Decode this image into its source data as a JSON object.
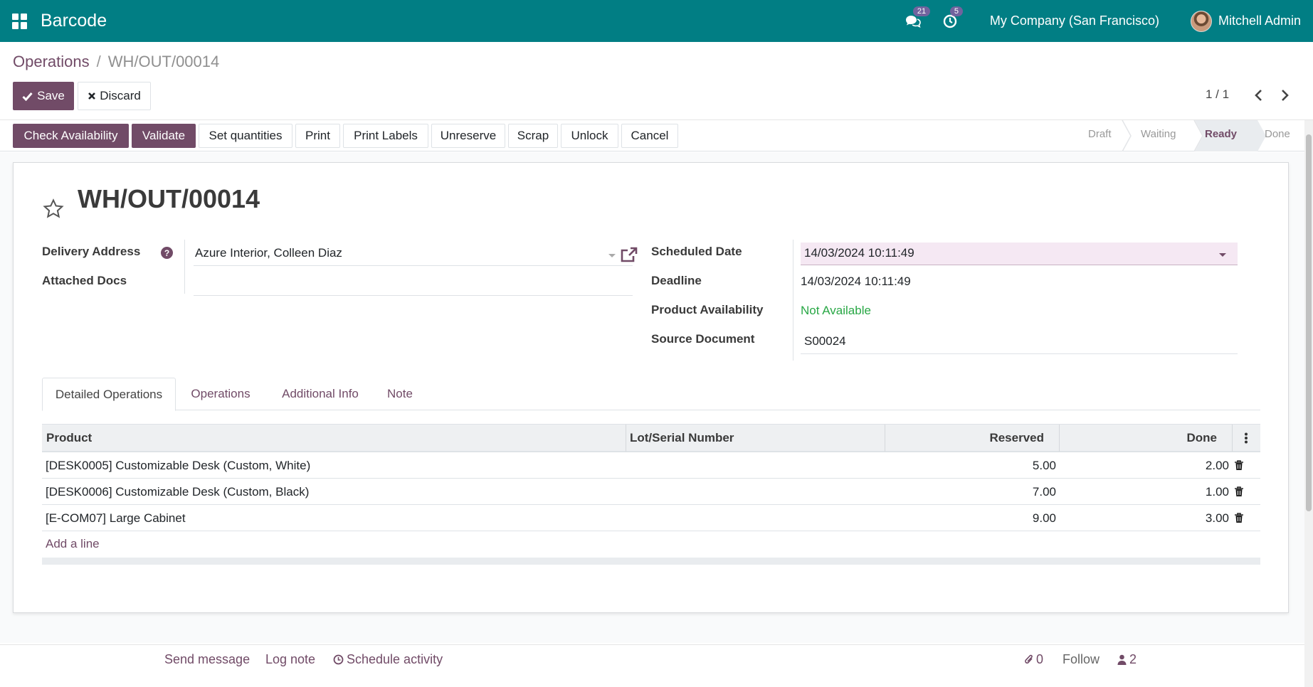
{
  "navbar": {
    "app_name": "Barcode",
    "messages_count": "21",
    "activities_count": "5",
    "company": "My Company (San Francisco)",
    "user": "Mitchell Admin",
    "bg_color": "#017e84"
  },
  "breadcrumb": {
    "parent": "Operations",
    "separator": "/",
    "current": "WH/OUT/00014"
  },
  "controls": {
    "save_label": "Save",
    "discard_label": "Discard",
    "pager": "1 / 1"
  },
  "actions": [
    {
      "label": "Check Availability"
    },
    {
      "label": "Validate"
    },
    {
      "label": "Set quantities"
    },
    {
      "label": "Print"
    },
    {
      "label": "Print Labels"
    },
    {
      "label": "Unreserve"
    },
    {
      "label": "Scrap"
    },
    {
      "label": "Unlock"
    },
    {
      "label": "Cancel"
    }
  ],
  "stages": [
    {
      "label": "Draft"
    },
    {
      "label": "Waiting"
    },
    {
      "label": "Ready",
      "active": true
    },
    {
      "label": "Done"
    }
  ],
  "form": {
    "title": "WH/OUT/00014",
    "delivery_address_label": "Delivery Address",
    "help_mark": "?",
    "delivery_address": "Azure Interior, Colleen Diaz",
    "attached_docs_label": "Attached Docs",
    "scheduled_date_label": "Scheduled Date",
    "scheduled_date": "14/03/2024 10:11:49",
    "deadline_label": "Deadline",
    "deadline": "14/03/2024 10:11:49",
    "availability_label": "Product Availability",
    "availability": "Not Available",
    "source_label": "Source Document",
    "source": "S00024"
  },
  "tabs": [
    {
      "label": "Detailed Operations",
      "active": true
    },
    {
      "label": "Operations"
    },
    {
      "label": "Additional Info"
    },
    {
      "label": "Note"
    }
  ],
  "table": {
    "headers": {
      "product": "Product",
      "lot": "Lot/Serial Number",
      "reserved": "Reserved",
      "done": "Done"
    },
    "rows": [
      {
        "product": "[DESK0005] Customizable Desk (Custom, White)",
        "reserved": "5.00",
        "done": "2.00"
      },
      {
        "product": "[DESK0006] Customizable Desk (Custom, Black)",
        "reserved": "7.00",
        "done": "1.00"
      },
      {
        "product": "[E-COM07] Large Cabinet",
        "reserved": "9.00",
        "done": "3.00"
      }
    ],
    "add_line": "Add a line"
  },
  "chatter": {
    "send_message": "Send message",
    "log_note": "Log note",
    "schedule_activity": "Schedule activity",
    "attachments": "0",
    "follow": "Follow",
    "followers": "2"
  },
  "colors": {
    "primary": "#714b67",
    "success": "#28a745"
  }
}
